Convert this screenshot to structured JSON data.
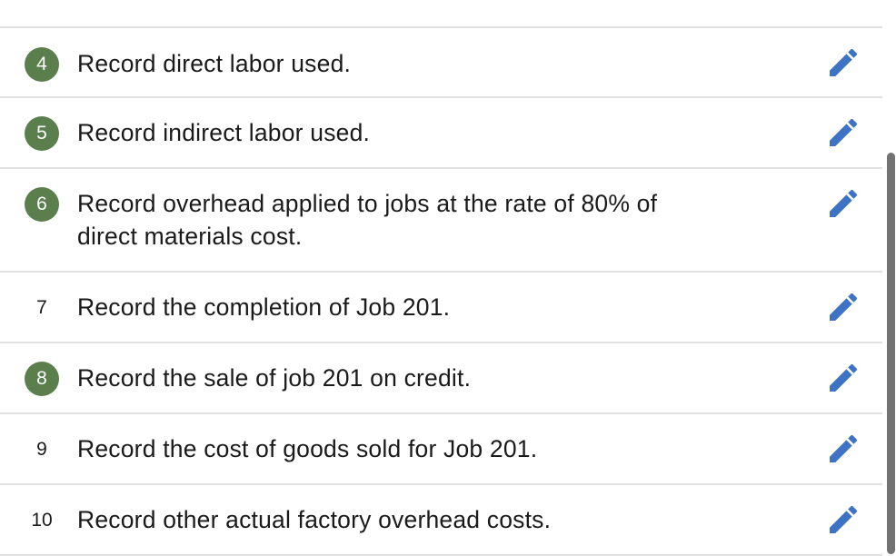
{
  "tasks": [
    {
      "number": "4",
      "completed": true,
      "text": "Record direct labor used.",
      "edit_icon": "pencil-icon"
    },
    {
      "number": "5",
      "completed": true,
      "text": "Record indirect labor used.",
      "edit_icon": "pencil-icon"
    },
    {
      "number": "6",
      "completed": true,
      "text_line1": "Record overhead applied to jobs at the rate of 80% of",
      "text_line2": "direct materials cost.",
      "edit_icon": "pencil-icon"
    },
    {
      "number": "7",
      "completed": false,
      "text": "Record the completion of Job 201.",
      "edit_icon": "pencil-icon"
    },
    {
      "number": "8",
      "completed": true,
      "text": "Record the sale of job 201 on credit.",
      "edit_icon": "pencil-icon"
    },
    {
      "number": "9",
      "completed": false,
      "text": "Record the cost of goods sold for Job 201.",
      "edit_icon": "pencil-icon"
    },
    {
      "number": "10",
      "completed": false,
      "text": "Record other actual factory overhead costs.",
      "edit_icon": "pencil-icon"
    }
  ],
  "colors": {
    "completed_badge": "#5a7f4c",
    "edit_icon": "#3d72c4",
    "divider": "#e0e0e0",
    "scrollbar_thumb": "#737373"
  }
}
